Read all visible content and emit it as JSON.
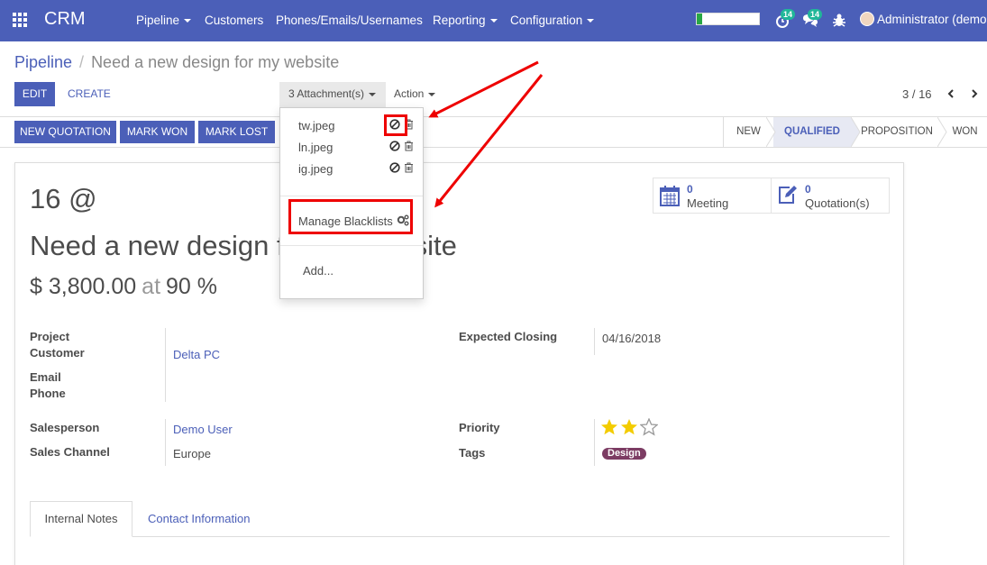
{
  "navbar": {
    "brand": "CRM",
    "menu": [
      {
        "label": "Pipeline",
        "dropdown": true
      },
      {
        "label": "Customers",
        "dropdown": false
      },
      {
        "label": "Phones/Emails/Usernames",
        "dropdown": false
      },
      {
        "label": "Reporting",
        "dropdown": true
      },
      {
        "label": "Configuration",
        "dropdown": true
      }
    ],
    "activity_badge": "14",
    "messages_badge": "14",
    "progress_fraction": 0.08,
    "user": "Administrator (demo"
  },
  "breadcrumb": {
    "parent": "Pipeline",
    "separator": "/",
    "current": "Need a new design for my website"
  },
  "control_panel": {
    "edit": "EDIT",
    "create": "CREATE",
    "attachments": "3 Attachment(s)",
    "action": "Action",
    "pager": "3 / 16"
  },
  "statusbar": {
    "buttons": [
      "NEW QUOTATION",
      "MARK WON",
      "MARK LOST"
    ],
    "stages": [
      "NEW",
      "QUALIFIED",
      "PROPOSITION",
      "WON"
    ],
    "active_stage": "QUALIFIED"
  },
  "attachments_dropdown": {
    "files": [
      "tw.jpeg",
      "ln.jpeg",
      "ig.jpeg"
    ],
    "manage": "Manage Blacklists",
    "add": "Add..."
  },
  "record": {
    "name_small": "16 @",
    "name_big": "Need a new design for my website",
    "revenue": "$ 3,800.00",
    "at": "at",
    "probability": "90 %",
    "smart_buttons": [
      {
        "count": "0",
        "label": "Meeting",
        "icon": "calendar-icon"
      },
      {
        "count": "0",
        "label": "Quotation(s)",
        "icon": "edit-icon"
      }
    ],
    "fields": {
      "project_label": "Project",
      "customer_label": "Customer",
      "customer": "Delta PC",
      "email_label": "Email",
      "phone_label": "Phone",
      "expected_closing_label": "Expected Closing",
      "expected_closing": "04/16/2018",
      "salesperson_label": "Salesperson",
      "salesperson": "Demo User",
      "sales_channel_label": "Sales Channel",
      "sales_channel": "Europe",
      "priority_label": "Priority",
      "priority_stars": 2,
      "priority_max": 3,
      "tags_label": "Tags",
      "tag": "Design"
    },
    "tabs": [
      "Internal Notes",
      "Contact Information"
    ]
  },
  "colors": {
    "brand": "#4b5fb8",
    "annotation": "#e00000",
    "star": "#f3cc00",
    "tag": "#7c3c63"
  }
}
